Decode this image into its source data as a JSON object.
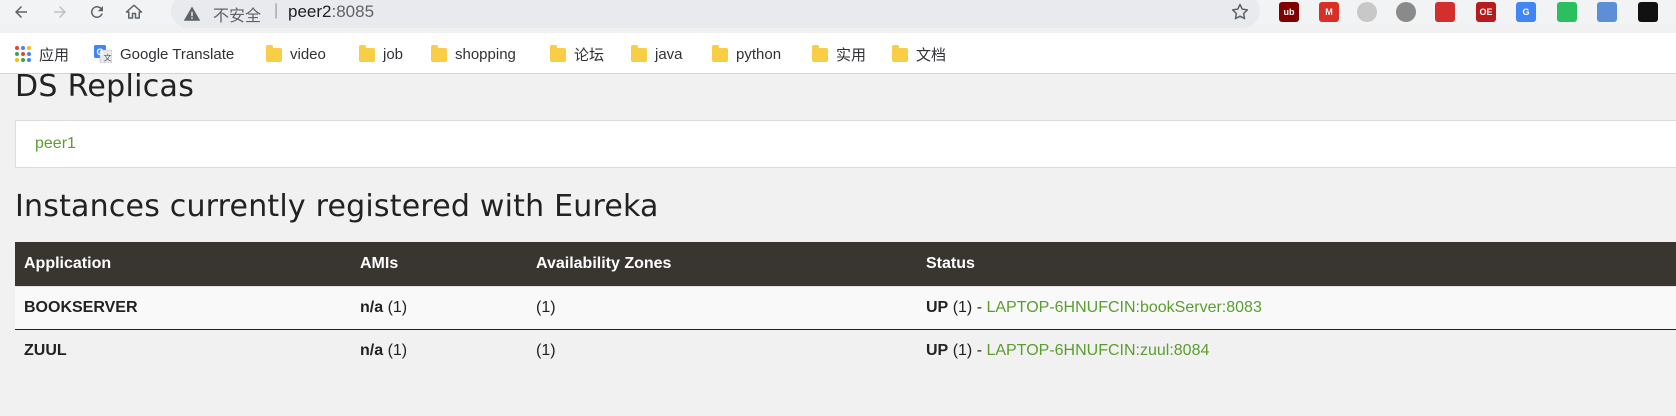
{
  "browser": {
    "address": {
      "security_label": "不安全",
      "separator": "|",
      "host": "peer2",
      "port": ":8085"
    },
    "extensions": [
      {
        "name": "ublock-icon",
        "color": "#800000",
        "label": "ub"
      },
      {
        "name": "gmail-icon",
        "color": "#d93025",
        "label": "M"
      },
      {
        "name": "grey-extension-icon",
        "color": "#c8c8c8",
        "label": ""
      },
      {
        "name": "circle-extension-icon",
        "color": "#8a8a8a",
        "label": ""
      },
      {
        "name": "blocker-extension-icon",
        "color": "#d32f2f",
        "label": ""
      },
      {
        "name": "oe-extension-icon",
        "color": "#b71c1c",
        "label": "OE"
      },
      {
        "name": "translate-extension-icon",
        "color": "#4285f4",
        "label": "G"
      },
      {
        "name": "evernote-icon",
        "color": "#2dbe60",
        "label": ""
      },
      {
        "name": "blue-extension-icon",
        "color": "#5c8fd6",
        "label": ""
      },
      {
        "name": "tampermonkey-icon",
        "color": "#111111",
        "label": ""
      }
    ]
  },
  "bookmarks": [
    {
      "label": "应用",
      "icon": "apps-icon"
    },
    {
      "label": "Google Translate",
      "icon": "google-translate-icon"
    },
    {
      "label": "video",
      "icon": "folder-icon"
    },
    {
      "label": "job",
      "icon": "folder-icon"
    },
    {
      "label": "shopping",
      "icon": "folder-icon"
    },
    {
      "label": "论坛",
      "icon": "folder-icon"
    },
    {
      "label": "java",
      "icon": "folder-icon"
    },
    {
      "label": "python",
      "icon": "folder-icon"
    },
    {
      "label": "实用",
      "icon": "folder-icon"
    },
    {
      "label": "文档",
      "icon": "folder-icon"
    }
  ],
  "page": {
    "replicas_title": "DS Replicas",
    "replica_link": "peer1",
    "instances_title": "Instances currently registered with Eureka",
    "table": {
      "headers": [
        "Application",
        "AMIs",
        "Availability Zones",
        "Status"
      ],
      "rows": [
        {
          "application": "BOOKSERVER",
          "ami_value": "n/a",
          "ami_count": "(1)",
          "zones": "(1)",
          "status": "UP",
          "status_count": "(1) -",
          "instance_link": "LAPTOP-6HNUFCIN:bookServer:8083"
        },
        {
          "application": "ZUUL",
          "ami_value": "n/a",
          "ami_count": "(1)",
          "zones": "(1)",
          "status": "UP",
          "status_count": "(1) -",
          "instance_link": "LAPTOP-6HNUFCIN:zuul:8084"
        }
      ]
    }
  },
  "colors": {
    "link_green": "#5a9e2f",
    "table_header_bg": "#393530",
    "page_bg": "#f1f1f1"
  }
}
